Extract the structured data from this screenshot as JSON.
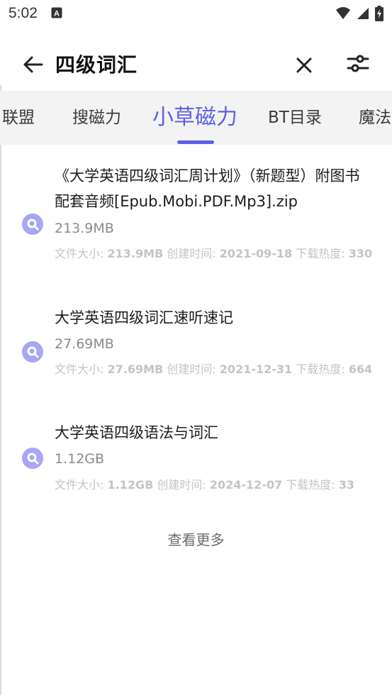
{
  "status_bar": {
    "time": "5:02",
    "notification_icon": "a-box-icon",
    "icons": [
      "wifi-icon",
      "signal-icon",
      "battery-charging-icon"
    ]
  },
  "toolbar": {
    "query": "四级词汇",
    "back_icon": "arrow-left-icon",
    "clear_icon": "close-icon",
    "filter_icon": "sliders-icon"
  },
  "tabs": [
    {
      "label": "联盟",
      "active": false
    },
    {
      "label": "搜磁力",
      "active": false
    },
    {
      "label": "小草磁力",
      "active": true
    },
    {
      "label": "BT目录",
      "active": false
    },
    {
      "label": "魔法",
      "active": false
    }
  ],
  "results": [
    {
      "title": "《大学英语四级词汇周计划》（新题型）附图书配套音频[Epub.Mobi.PDF.Mp3].zip",
      "size": "213.9MB",
      "meta": {
        "size_label": "文件大小: ",
        "size_value": "213.9MB",
        "created_label": " 创建时间: ",
        "created_value": "2021-09-18",
        "hot_label": " 下载热度: ",
        "hot_value": "330"
      }
    },
    {
      "title": "大学英语四级词汇速听速记",
      "size": "27.69MB",
      "meta": {
        "size_label": "文件大小: ",
        "size_value": "27.69MB",
        "created_label": " 创建时间: ",
        "created_value": "2021-12-31",
        "hot_label": " 下载热度: ",
        "hot_value": "664"
      }
    },
    {
      "title": "大学英语四级语法与词汇",
      "size": "1.12GB",
      "meta": {
        "size_label": "文件大小: ",
        "size_value": "1.12GB",
        "created_label": " 创建时间: ",
        "created_value": "2024-12-07",
        "hot_label": " 下载热度: ",
        "hot_value": "33"
      }
    }
  ],
  "more_label": "查看更多",
  "colors": {
    "accent": "#5b5fe6",
    "icon_ring": "#a9a6f5",
    "meta_text": "#c4c4c4"
  }
}
